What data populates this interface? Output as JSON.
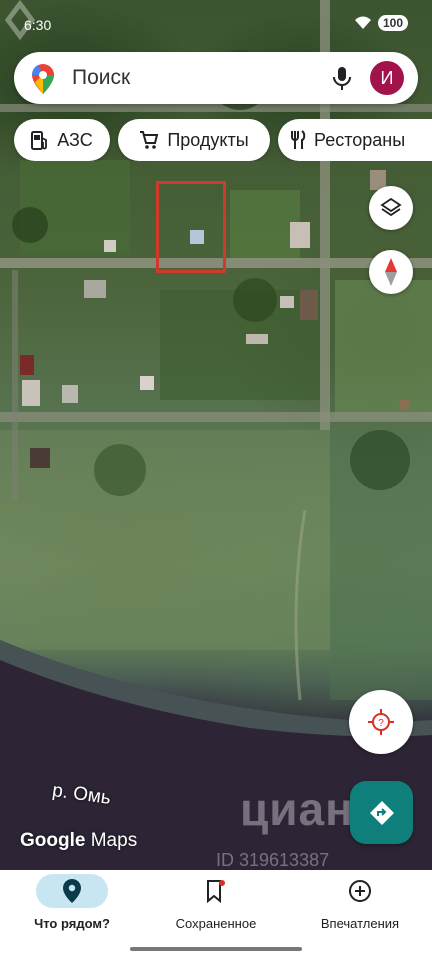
{
  "status_bar": {
    "time": "6:30",
    "battery": "100"
  },
  "search": {
    "placeholder": "Поиск",
    "avatar_letter": "И"
  },
  "chips": [
    {
      "label": "АЗС",
      "icon": "gas-station-icon"
    },
    {
      "label": "Продукты",
      "icon": "cart-icon"
    },
    {
      "label": "Рестораны",
      "icon": "restaurant-icon"
    }
  ],
  "map": {
    "river_label": "р. Омь",
    "logo": {
      "brand": "Google",
      "product": "Maps"
    },
    "watermark": {
      "text": "циан",
      "id": "ID 319613387"
    }
  },
  "bottom_nav": {
    "tabs": [
      {
        "label": "Что рядом?",
        "icon": "location-pin-icon",
        "active": true
      },
      {
        "label": "Сохраненное",
        "icon": "bookmark-icon",
        "active": false
      },
      {
        "label": "Впечатления",
        "icon": "add-circle-icon",
        "active": false
      }
    ]
  },
  "colors": {
    "avatar": "#a3134b",
    "navigation_fab": "#0f7f7c",
    "active_tab_bg": "#c7e6f2",
    "highlight_border": "#d03a2a"
  }
}
